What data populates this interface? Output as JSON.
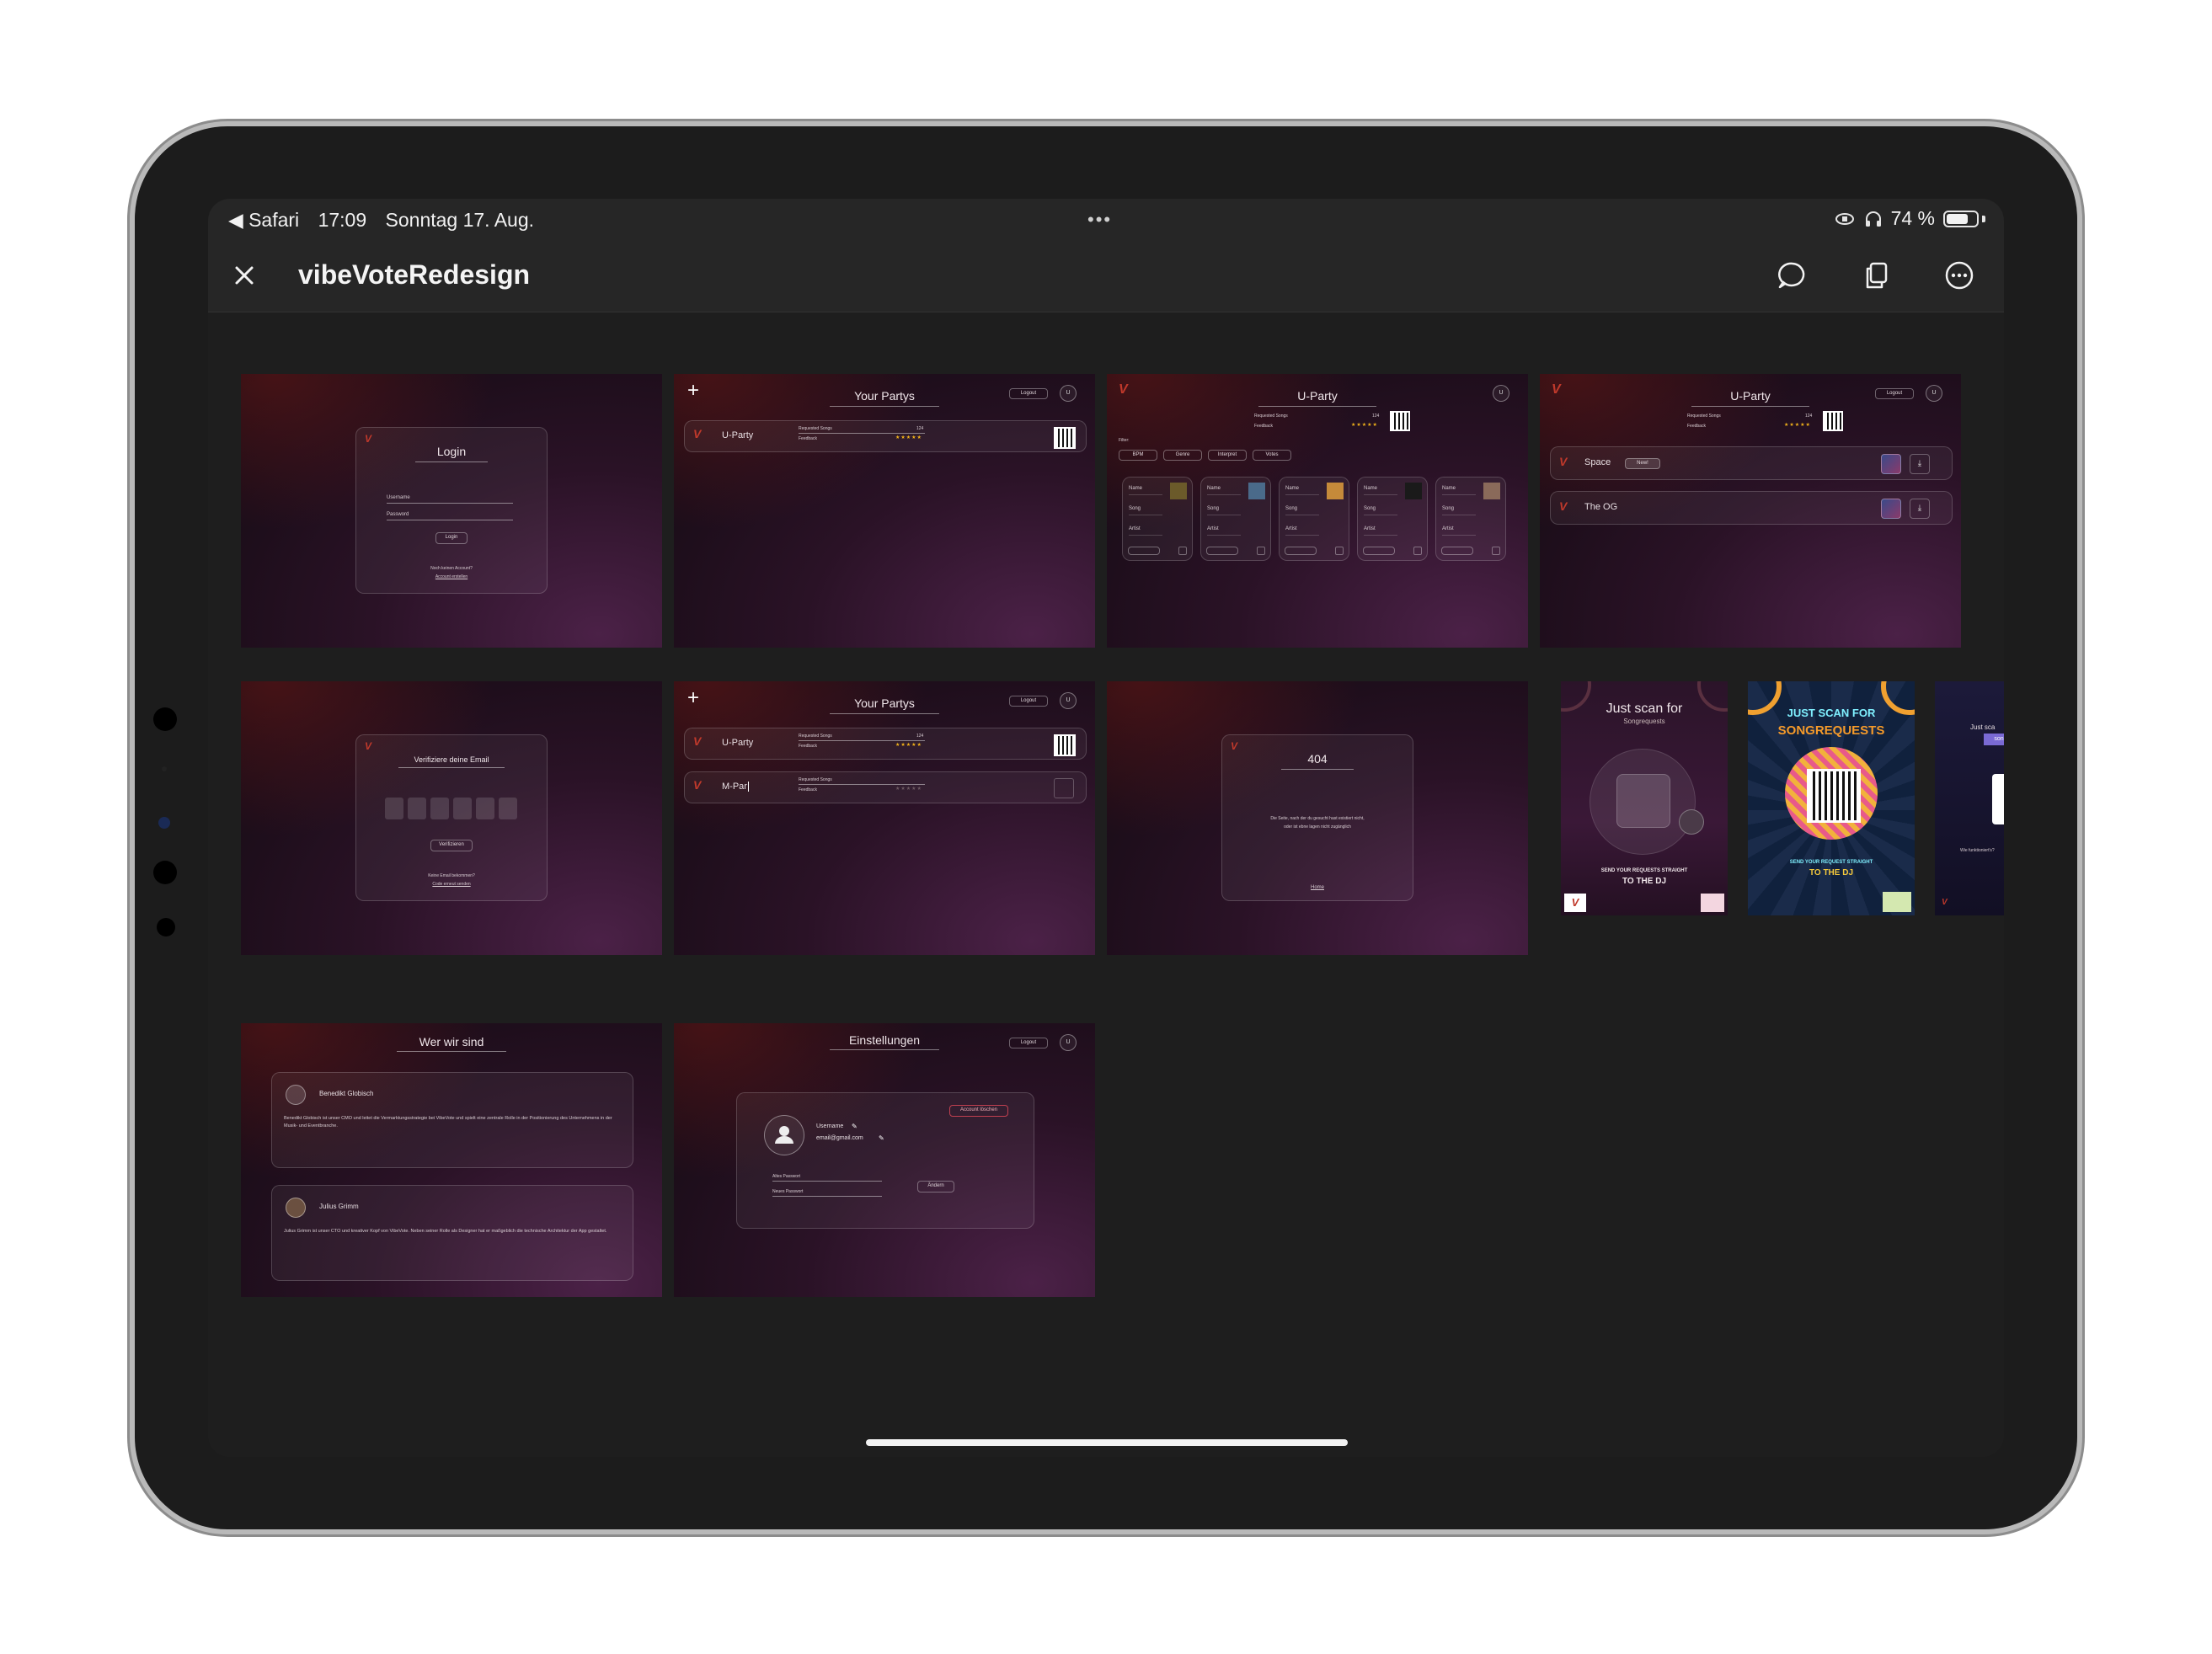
{
  "statusbar": {
    "back_app": "◀ Safari",
    "time": "17:09",
    "date": "Sonntag 17. Aug.",
    "multitask_dots": "•••",
    "battery_percent": "74 %",
    "battery_level": 0.74
  },
  "navbar": {
    "title": "vibeVoteRedesign",
    "close_icon": "close-icon",
    "comment_icon": "comment-icon",
    "copy_icon": "copy-icon",
    "more_icon": "more-icon"
  },
  "thumbs": {
    "login": {
      "title": "Login",
      "username": "Username",
      "password": "Password",
      "button": "Login",
      "prompt": "Noch keinen Account?",
      "link": "Account erstellen"
    },
    "partys": {
      "title": "Your Partys",
      "logout": "Logout",
      "avatar": "U",
      "party_name": "U-Party",
      "requested": "Requested Songs",
      "count": "124",
      "feedback": "Feedback",
      "stars": "★★★★★"
    },
    "uparty_grid": {
      "title": "U-Party",
      "avatar": "U",
      "requested": "Requested Songs",
      "count": "124",
      "feedback": "Feedback",
      "stars": "★★★★★",
      "filter": "Filter:",
      "filters": [
        "BPM",
        "Genre",
        "Interpret",
        "Votes"
      ],
      "card_labels": [
        "Name",
        "Song",
        "Artist"
      ]
    },
    "uparty_lists": {
      "title": "U-Party",
      "logout": "Logout",
      "avatar": "U",
      "requested": "Requested Songs",
      "count": "124",
      "feedback": "Feedback",
      "stars": "★★★★★",
      "rows": [
        {
          "name": "Space",
          "badge": "New!"
        },
        {
          "name": "The OG",
          "badge": ""
        }
      ]
    },
    "verify": {
      "title": "Verifiziere deine Email",
      "button": "Verifizieren",
      "prompt": "Keine Email bekommen?",
      "link": "Code erneut senden"
    },
    "partys2": {
      "title": "Your Partys",
      "logout": "Logout",
      "avatar": "U",
      "party1": "U-Party",
      "party2": "M-Par",
      "requested": "Requested Songs",
      "count": "124",
      "feedback": "Feedback",
      "stars1": "★★★★★",
      "stars2": "★★★★★"
    },
    "notfound": {
      "title": "404",
      "line1": "Die Seite, nach der du gesucht hast existiert nicht,",
      "line2": "oder ist ebne lagen nicht zugänglich",
      "link": "Home"
    },
    "about": {
      "title": "Wer wir sind",
      "person1": "Benedikt Globisch",
      "bio1": "Benedikt Globisch ist unser CMO und leitet die Vermarktungsstrategie bei VibeVote und spielt eine zentrale Rolle in der Positionierung des Unternehmens in der Musik- und Eventbranche.",
      "person2": "Julius Grimm",
      "bio2": "Julius Grimm ist unser CTO und kreativer Kopf von VibeVote. Neben seiner Rolle als Designer hat er maßgeblich die technische Architektur der App gestaltet."
    },
    "settings": {
      "title": "Einstellungen",
      "logout": "Logout",
      "avatar": "U",
      "delete": "Account löschen",
      "username": "Username",
      "email": "email@gmail.com",
      "old_pw": "Altes Passwort",
      "new_pw": "Neues Passwort",
      "change": "Ändern"
    },
    "poster1": {
      "title": "Just scan for",
      "subtitle": "Songrequests",
      "line1": "SEND YOUR REQUESTS STRAIGHT",
      "line2": "TO THE DJ"
    },
    "poster2": {
      "title": "JUST SCAN FOR",
      "subtitle": "SONGREQUESTS",
      "line1": "SEND YOUR REQUEST STRAIGHT",
      "line2": "TO THE DJ"
    },
    "poster3": {
      "title": "Just sca",
      "badge": "song",
      "footer": "Wie funktioniert's?"
    }
  }
}
